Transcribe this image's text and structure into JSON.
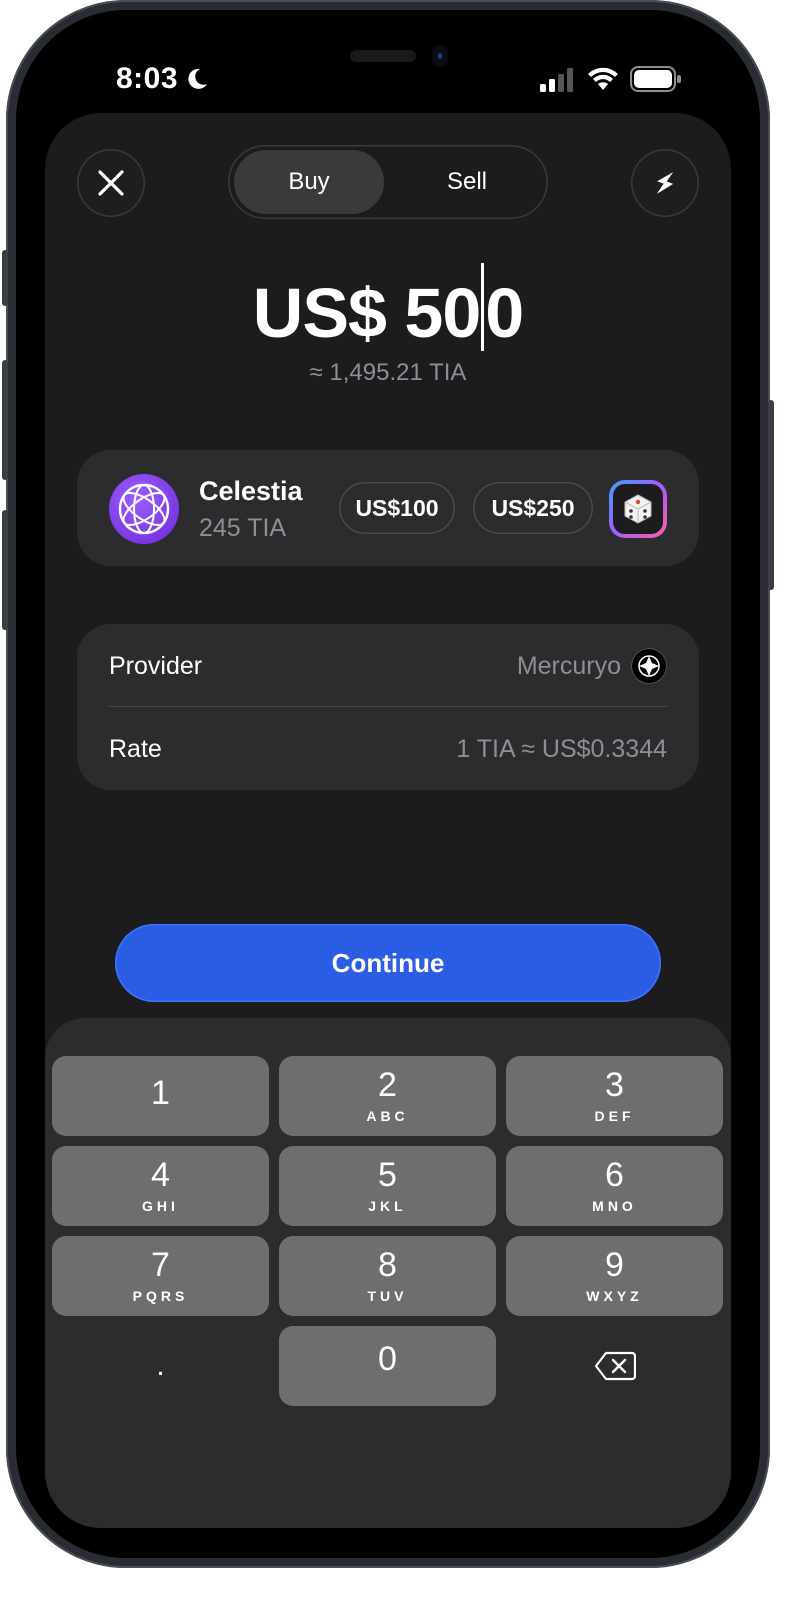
{
  "status_bar": {
    "time": "8:03"
  },
  "header": {
    "segments": [
      "Buy",
      "Sell"
    ],
    "active_segment": "Buy"
  },
  "amount": {
    "before_caret": "US$ 50",
    "after_caret": "0",
    "approx": "≈ 1,495.21 TIA"
  },
  "asset": {
    "name": "Celestia",
    "balance": "245 TIA",
    "presets": [
      "US$100",
      "US$250"
    ]
  },
  "details": {
    "provider_label": "Provider",
    "provider_value": "Mercuryo",
    "rate_label": "Rate",
    "rate_value": "1 TIA ≈ US$0.3344"
  },
  "continue_label": "Continue",
  "keypad": {
    "keys": [
      {
        "num": "1",
        "letters": ""
      },
      {
        "num": "2",
        "letters": "ABC"
      },
      {
        "num": "3",
        "letters": "DEF"
      },
      {
        "num": "4",
        "letters": "GHI"
      },
      {
        "num": "5",
        "letters": "JKL"
      },
      {
        "num": "6",
        "letters": "MNO"
      },
      {
        "num": "7",
        "letters": "PQRS"
      },
      {
        "num": "8",
        "letters": "TUV"
      },
      {
        "num": "9",
        "letters": "WXYZ"
      },
      {
        "num": "0",
        "letters": ""
      }
    ],
    "decimal": "."
  },
  "colors": {
    "accent": "#2b5ce4",
    "background": "#1c1c1e",
    "card": "#2c2c2e"
  },
  "icons": [
    "close-icon",
    "lightning-icon",
    "dice-icon",
    "globe-logo-icon",
    "mercuryo-logo-icon",
    "backspace-icon"
  ]
}
